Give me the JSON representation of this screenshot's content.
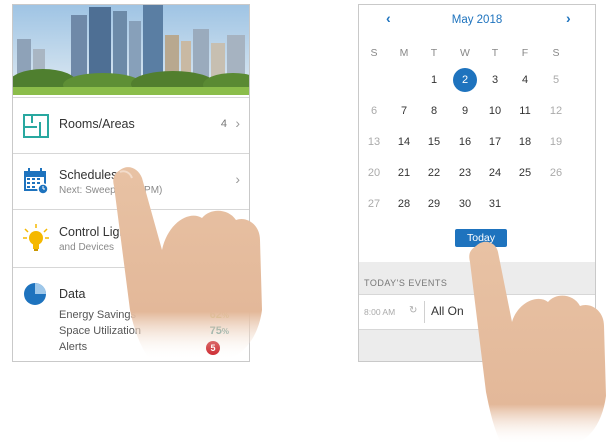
{
  "left_phone": {
    "menu": [
      {
        "label": "Rooms/Areas",
        "count": "4",
        "icon": "floorplan-icon"
      },
      {
        "label": "Schedules",
        "subtitle": "Next: Sweep (8:00 PM)",
        "icon": "calendar-clock-icon"
      },
      {
        "label": "Control Lights",
        "subtitle": "and Devices",
        "icon": "lightbulb-icon"
      }
    ],
    "data_section": {
      "title": "Data",
      "icon": "pie-chart-icon",
      "energy_label": "Energy Savings",
      "energy_value": "62",
      "space_label": "Space Utilization",
      "space_value": "75",
      "percent": "%",
      "alerts_label": "Alerts",
      "alerts_count": "5"
    },
    "colors": {
      "energy": "#9bbb3c",
      "space": "#3f8f8f",
      "alerts": "#c8161d",
      "accent_icon": "#29a8a0"
    }
  },
  "right_phone": {
    "calendar": {
      "month": "May 2018",
      "weekdays": [
        "S",
        "M",
        "T",
        "W",
        "T",
        "F",
        "S"
      ],
      "weeks": [
        [
          "",
          "",
          "1",
          "2",
          "3",
          "4",
          "5"
        ],
        [
          "6",
          "7",
          "8",
          "9",
          "10",
          "11",
          "12"
        ],
        [
          "13",
          "14",
          "15",
          "16",
          "17",
          "18",
          "19"
        ],
        [
          "20",
          "21",
          "22",
          "23",
          "24",
          "25",
          "26"
        ],
        [
          "27",
          "28",
          "29",
          "30",
          "31",
          "",
          ""
        ]
      ],
      "selected_day": "2",
      "today_label": "Today"
    },
    "events": {
      "title": "TODAY'S EVENTS",
      "items": [
        {
          "time": "8:00 AM",
          "name": "All On"
        }
      ]
    },
    "colors": {
      "accent": "#1e73be"
    }
  }
}
